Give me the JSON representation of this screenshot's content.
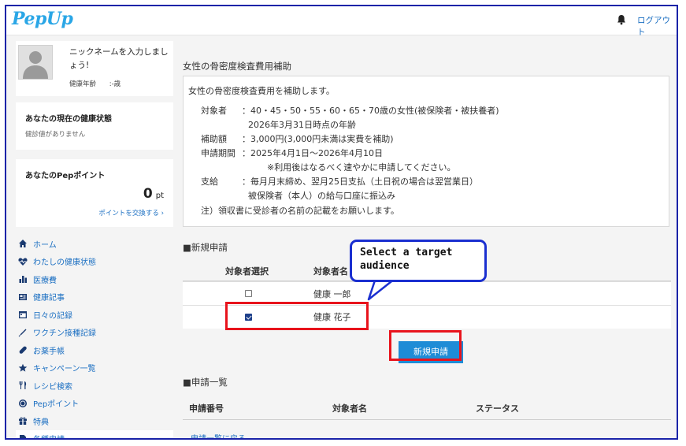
{
  "header": {
    "logo": "PepUp",
    "logout_label": "ログアウト"
  },
  "profile": {
    "nickname": "ニックネームを入力しましょう!",
    "age_label": "健康年齢",
    "age_value": ":-歳"
  },
  "health_card": {
    "title": "あなたの現在の健康状態",
    "subtitle": "健診値がありません"
  },
  "points_card": {
    "title": "あなたのPepポイント",
    "value": "0",
    "unit": "pt",
    "exchange_link": "ポイントを交換する ›"
  },
  "nav": {
    "items": [
      {
        "label": "ホーム",
        "icon": "home-icon"
      },
      {
        "label": "わたしの健康状態",
        "icon": "heartbeat-icon"
      },
      {
        "label": "医療費",
        "icon": "bar-chart-icon"
      },
      {
        "label": "健康記事",
        "icon": "article-icon"
      },
      {
        "label": "日々の記録",
        "icon": "calendar-icon"
      },
      {
        "label": "ワクチン接種記録",
        "icon": "syringe-icon"
      },
      {
        "label": "お薬手帳",
        "icon": "pill-icon"
      },
      {
        "label": "キャンペーン一覧",
        "icon": "star-icon"
      },
      {
        "label": "レシピ検索",
        "icon": "fork-knife-icon"
      },
      {
        "label": "Pepポイント",
        "icon": "coin-icon"
      },
      {
        "label": "特典",
        "icon": "gift-icon"
      },
      {
        "label": "各種申請",
        "icon": "document-icon"
      }
    ]
  },
  "main": {
    "title": "女性の骨密度検査費用補助",
    "info": {
      "intro": "女性の骨密度検査費用を補助します。",
      "target_label": "対象者",
      "target_value": "：40・45・50・55・60・65・70歳の女性(被保険者・被扶養者)",
      "target_note": "2026年3月31日時点の年齢",
      "amount_label": "補助額",
      "amount_value": "：3,000円(3,000円未満は実費を補助)",
      "period_label": "申請期間",
      "period_value": "：2025年4月1日～2026年4月10日",
      "period_note": "※利用後はなるべく速やかに申請してください。",
      "payment_label": "支給",
      "payment_value": "：毎月月末締め、翌月25日支払（土日祝の場合は翌営業日）",
      "payment_note": "被保険者（本人）の給与口座に振込み",
      "notice": "注）領収書に受診者の名前の記載をお願いします。"
    },
    "new_application": {
      "section_title": "■新規申請",
      "col_select": "対象者選択",
      "col_name": "対象者名",
      "rows": [
        {
          "name": "健康 一郎",
          "checked": false
        },
        {
          "name": "健康 花子",
          "checked": true
        }
      ],
      "button_label": "新規申請"
    },
    "application_list": {
      "section_title": "■申請一覧",
      "col_number": "申請番号",
      "col_name": "対象者名",
      "col_status": "ステータス",
      "back_link": "申請一覧に戻る"
    },
    "callout": "Select a target audience"
  }
}
